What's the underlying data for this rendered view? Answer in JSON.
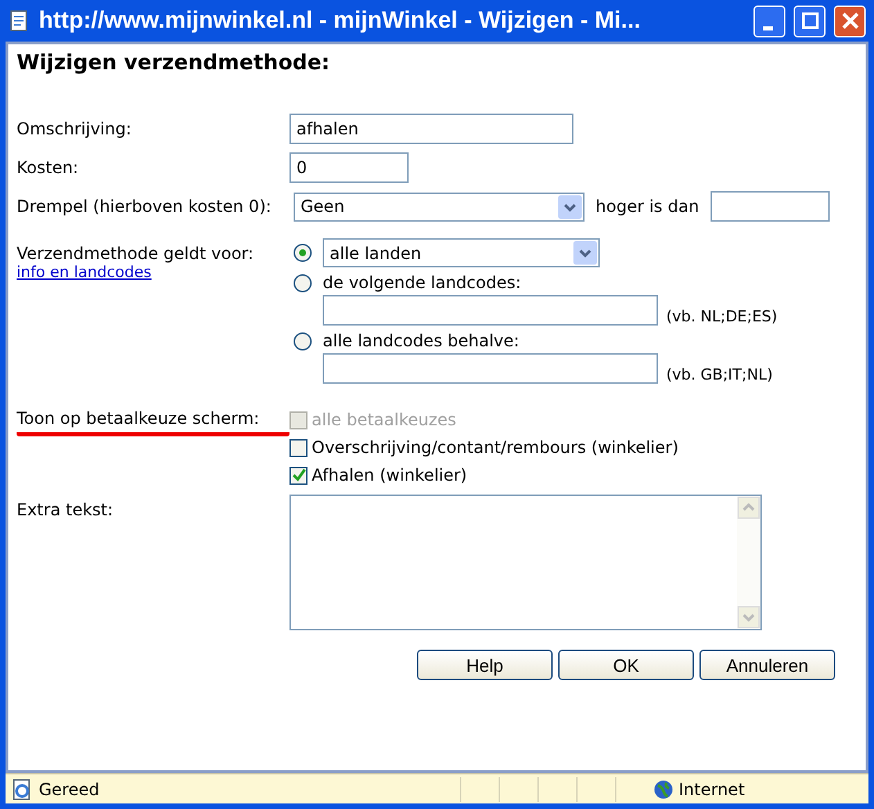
{
  "window": {
    "title": "http://www.mijnwinkel.nl - mijnWinkel - Wijzigen - Mi..."
  },
  "heading": "Wijzigen verzendmethode:",
  "omschrijving": {
    "label": "Omschrijving:",
    "value": "afhalen"
  },
  "kosten": {
    "label": "Kosten:",
    "value": "0"
  },
  "drempel": {
    "label": "Drempel (hierboven kosten 0):",
    "value": "Geen",
    "after": "hoger is dan"
  },
  "scope": {
    "label": "Verzendmethode geldt voor:",
    "link": "info en landcodes",
    "options": [
      {
        "kind": "select",
        "selected": true,
        "value": "alle landen"
      },
      {
        "kind": "codes",
        "selected": false,
        "label": "de volgende landcodes:",
        "hint": "(vb. NL;DE;ES)"
      },
      {
        "kind": "codes",
        "selected": false,
        "label": "alle landcodes behalve:",
        "hint": "(vb. GB;IT;NL)"
      }
    ]
  },
  "payment": {
    "label": "Toon op betaalkeuze scherm:",
    "options": [
      {
        "label": "alle betaalkeuzes",
        "checked": false,
        "disabled": true
      },
      {
        "label": "Overschrijving/contant/rembours (winkelier)",
        "checked": false,
        "disabled": false
      },
      {
        "label": "Afhalen (winkelier)",
        "checked": true,
        "disabled": false
      }
    ]
  },
  "extra": {
    "label": "Extra tekst:"
  },
  "buttons": [
    "Help",
    "OK",
    "Annuleren"
  ],
  "status_bar": {
    "text": "Gereed",
    "zone": "Internet"
  }
}
